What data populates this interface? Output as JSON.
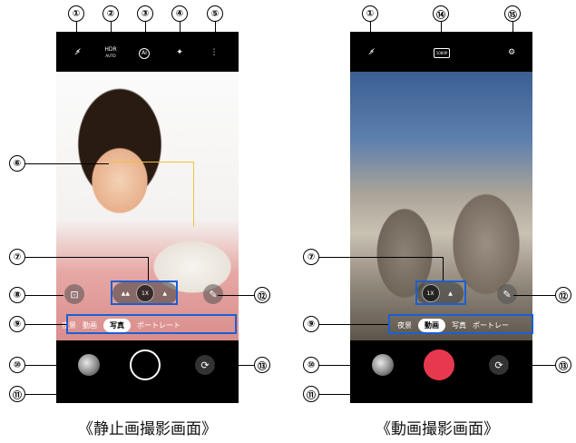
{
  "callouts": {
    "c1": "①",
    "c2": "②",
    "c3": "③",
    "c4": "④",
    "c5": "⑤",
    "c6": "⑥",
    "c7": "⑦",
    "c8": "⑧",
    "c9": "⑨",
    "c10": "⑩",
    "c11": "⑪",
    "c12": "⑫",
    "c13": "⑬",
    "c14": "⑭",
    "c15": "⑮"
  },
  "still": {
    "topbar": {
      "hdr_label": "HDR",
      "hdr_sub": "AUTO",
      "ai_label": "AI",
      "more_label": "⋮"
    },
    "zoom": {
      "left": "▲▲",
      "center": "1X",
      "right": "▲"
    },
    "modes": [
      "夜景",
      "動画",
      "写真",
      "ポートレート"
    ],
    "active_mode": "写真",
    "caption": "《静止画撮影画面》"
  },
  "video": {
    "topbar": {
      "res_label": "1080P"
    },
    "zoom": {
      "center": "1X",
      "right": "▲"
    },
    "modes": [
      "夜景",
      "動画",
      "写真",
      "ポートレー"
    ],
    "active_mode": "動画",
    "caption": "《動画撮影画面》"
  },
  "colors": {
    "highlight": "#1a5fd6",
    "record": "#e8384f"
  }
}
